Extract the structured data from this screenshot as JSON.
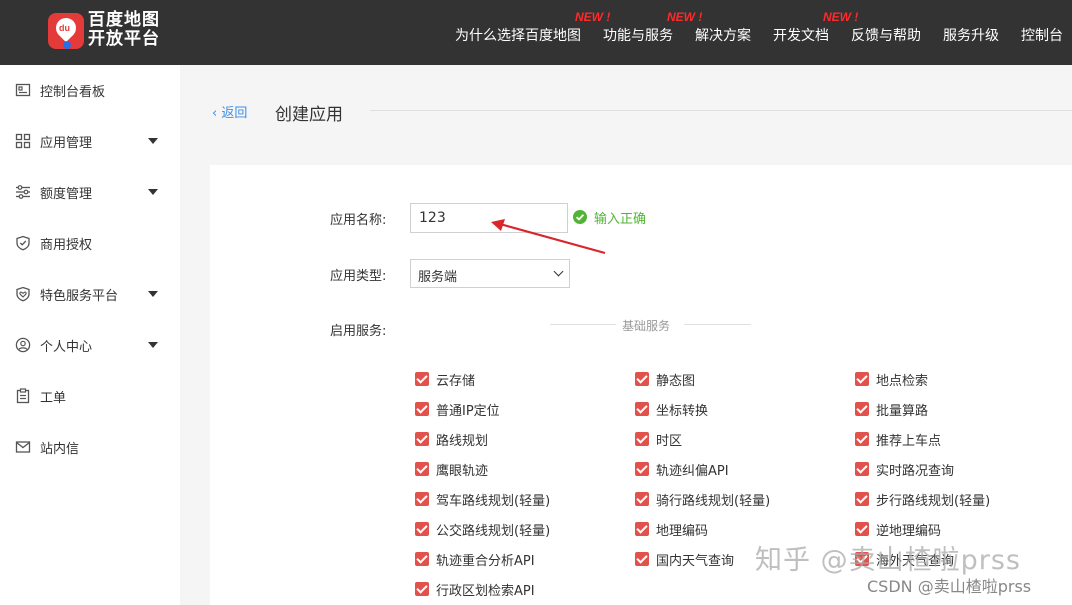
{
  "header": {
    "logo_text_line1": "百度地图",
    "logo_text_line2": "开放平台",
    "logo_badge": "du",
    "nav": [
      {
        "label": "为什么选择百度地图",
        "new": ""
      },
      {
        "label": "功能与服务",
        "new": "NEW !"
      },
      {
        "label": "解决方案",
        "new": "NEW !"
      },
      {
        "label": "开发文档",
        "new": "NEW !"
      },
      {
        "label": "反馈与帮助",
        "new": ""
      },
      {
        "label": "服务升级",
        "new": ""
      },
      {
        "label": "控制台",
        "new": ""
      }
    ]
  },
  "sidebar": {
    "items": [
      {
        "label": "控制台看板",
        "icon": "dashboard-icon",
        "expandable": false
      },
      {
        "label": "应用管理",
        "icon": "grid-icon",
        "expandable": true
      },
      {
        "label": "额度管理",
        "icon": "sliders-icon",
        "expandable": true
      },
      {
        "label": "商用授权",
        "icon": "shield-check-icon",
        "expandable": false
      },
      {
        "label": "特色服务平台",
        "icon": "shield-heart-icon",
        "expandable": true
      },
      {
        "label": "个人中心",
        "icon": "user-icon",
        "expandable": true
      },
      {
        "label": "工单",
        "icon": "clipboard-icon",
        "expandable": false
      },
      {
        "label": "站内信",
        "icon": "mail-icon",
        "expandable": false
      }
    ]
  },
  "page": {
    "back_label": "返回",
    "title": "创建应用"
  },
  "form": {
    "app_name_label": "应用名称:",
    "app_name_value": "123",
    "app_name_status": "输入正确",
    "app_type_label": "应用类型:",
    "app_type_value": "服务端",
    "services_label": "启用服务:",
    "services_section_title": "基础服务",
    "services": [
      {
        "label": "云存储",
        "checked": true
      },
      {
        "label": "静态图",
        "checked": true
      },
      {
        "label": "地点检索",
        "checked": true
      },
      {
        "label": "普通IP定位",
        "checked": true
      },
      {
        "label": "坐标转换",
        "checked": true
      },
      {
        "label": "批量算路",
        "checked": true
      },
      {
        "label": "路线规划",
        "checked": true
      },
      {
        "label": "时区",
        "checked": true
      },
      {
        "label": "推荐上车点",
        "checked": true
      },
      {
        "label": "鹰眼轨迹",
        "checked": true
      },
      {
        "label": "轨迹纠偏API",
        "checked": true
      },
      {
        "label": "实时路况查询",
        "checked": true
      },
      {
        "label": "驾车路线规划(轻量)",
        "checked": true
      },
      {
        "label": "骑行路线规划(轻量)",
        "checked": true
      },
      {
        "label": "步行路线规划(轻量)",
        "checked": true
      },
      {
        "label": "公交路线规划(轻量)",
        "checked": true
      },
      {
        "label": "地理编码",
        "checked": true
      },
      {
        "label": "逆地理编码",
        "checked": true
      },
      {
        "label": "轨迹重合分析API",
        "checked": true
      },
      {
        "label": "国内天气查询",
        "checked": true
      },
      {
        "label": "海外天气查询",
        "checked": true
      },
      {
        "label": "行政区划检索API",
        "checked": true
      }
    ]
  },
  "watermark": {
    "zhihu": "知乎 @卖山楂啦prss",
    "csdn": "CSDN @卖山楂啦prss"
  },
  "colors": {
    "topbar": "#333333",
    "accent_red": "#e2524c",
    "success_green": "#52b435",
    "link_blue": "#3d8ee6",
    "new_badge": "#ff2a2a"
  }
}
